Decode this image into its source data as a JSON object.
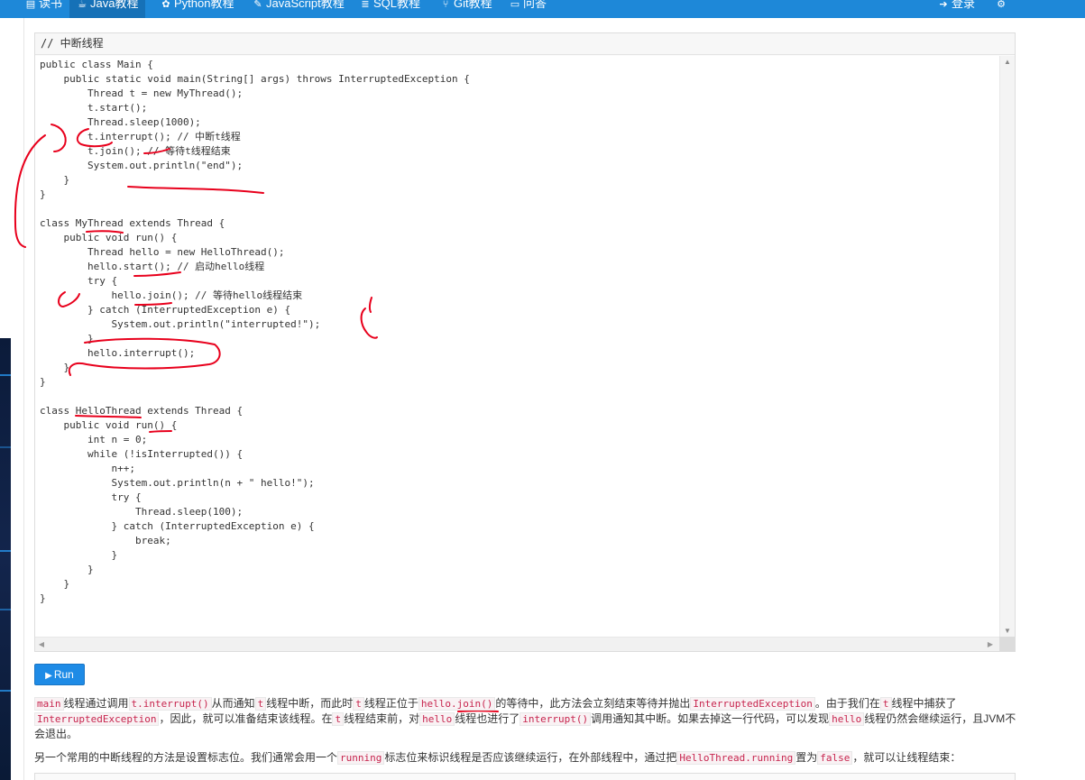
{
  "nav": {
    "items": [
      {
        "label": "读书",
        "icon": "book-icon",
        "glyph": "▤"
      },
      {
        "label": "Java教程",
        "icon": "cup-icon",
        "glyph": "☕",
        "active": true
      },
      {
        "label": "Python教程",
        "icon": "python-icon",
        "glyph": "✿"
      },
      {
        "label": "JavaScript教程",
        "icon": "js-icon",
        "glyph": "✎"
      },
      {
        "label": "SQL教程",
        "icon": "database-icon",
        "glyph": "≣"
      },
      {
        "label": "Git教程",
        "icon": "git-icon",
        "glyph": "⑂"
      },
      {
        "label": "问答",
        "icon": "chat-icon",
        "glyph": "▭"
      }
    ],
    "login": "登录",
    "login_glyph": "➔",
    "settings_glyph": "⚙"
  },
  "code": {
    "header": "// 中断线程",
    "lines": [
      "public class Main {",
      "    public static void main(String[] args) throws InterruptedException {",
      "        Thread t = new MyThread();",
      "        t.start();",
      "        Thread.sleep(1000);",
      "        t.interrupt(); // 中断t线程",
      "        t.join(); // 等待t线程结束",
      "        System.out.println(\"end\");",
      "    }",
      "}",
      "",
      "class MyThread extends Thread {",
      "    public void run() {",
      "        Thread hello = new HelloThread();",
      "        hello.start(); // 启动hello线程",
      "        try {",
      "            hello.join(); // 等待hello线程结束",
      "        } catch (InterruptedException e) {",
      "            System.out.println(\"interrupted!\");",
      "        }",
      "        hello.interrupt();",
      "    }",
      "}",
      "",
      "class HelloThread extends Thread {",
      "    public void run() {",
      "        int n = 0;",
      "        while (!isInterrupted()) {",
      "            n++;",
      "            System.out.println(n + \" hello!\");",
      "            try {",
      "                Thread.sleep(100);",
      "            } catch (InterruptedException e) {",
      "                break;",
      "            }",
      "        }",
      "    }",
      "}"
    ],
    "scroll_up": "▲",
    "scroll_down": "▼",
    "scroll_left": "◀",
    "scroll_right": "▶"
  },
  "run_button": {
    "glyph": "▶",
    "label": "Run"
  },
  "para1": {
    "t1": "main",
    "t2": "线程通过调用",
    "t3": "t.interrupt()",
    "t4": "从而通知",
    "t5": "t",
    "t6": "线程中断，而此时",
    "t7": "t",
    "t8": "线程正位于",
    "t9": "hello.join()",
    "t10": "的等待中，此方法会立刻结束等待并抛出",
    "t11": "InterruptedException",
    "t12": "。由于我们在",
    "t13": "t",
    "t14": "线程中捕获了",
    "t15": "InterruptedException",
    "t16": "，因此，就可以准备结束该线程。在",
    "t17": "t",
    "t18": "线程结束前，对",
    "t19": "hello",
    "t20": "线程也进行了",
    "t21": "interrupt()",
    "t22": "调用通知其中断。如果去掉这一行代码，可以发现",
    "t23": "hello",
    "t24": "线程仍然会继续运行，且JVM不会退出。"
  },
  "para2": {
    "t1": "另一个常用的中断线程的方法是设置标志位。我们通常会用一个",
    "t2": "running",
    "t3": "标志位来标识线程是否应该继续运行，在外部线程中，通过把",
    "t4": "HelloThread.running",
    "t5": "置为",
    "t6": "false",
    "t7": "，就可以让线程结束："
  },
  "colors": {
    "nav_bg": "#1e88d8",
    "annotation": "#e8001c",
    "inline_code": "#c7254e",
    "run_button": "#1e8be6"
  }
}
